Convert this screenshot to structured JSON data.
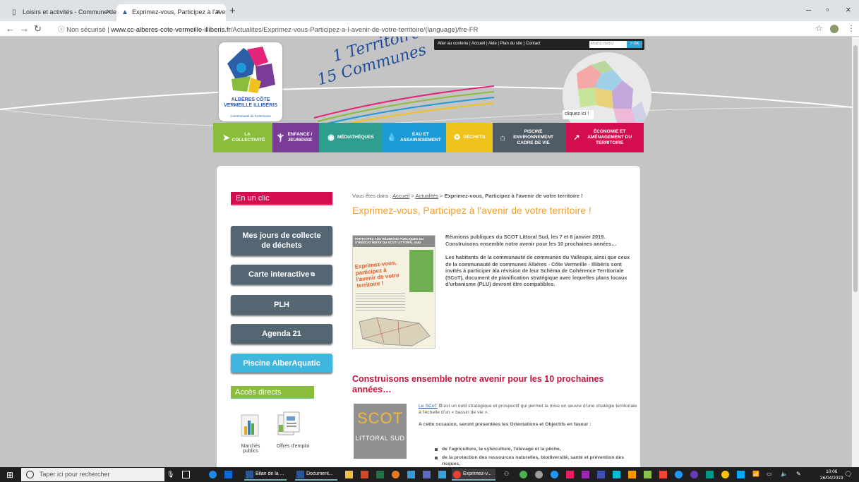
{
  "browser": {
    "tabs": [
      {
        "label": "Loisirs et activités - Commune de"
      },
      {
        "label": "Exprimez-vous, Participez à l'aven"
      }
    ],
    "security_label": "Non sécurisé",
    "url_host": "www.cc-alberes-cote-vermeille-illiberis.fr",
    "url_path": "/Actualites/Exprimez-vous-Participez-a-l-avenir-de-votre-territoire/(language)/fre-FR"
  },
  "header": {
    "logo_name": "ALBÈRES CÔTE VERMEILLE ILLIBÉRIS",
    "logo_sub": "Communauté de Communes",
    "slogan_line1": "1 Territoire",
    "slogan_line2": "15 Communes",
    "top_links": [
      "Aller au contenu",
      "Accueil",
      "Aide",
      "Plan du site",
      "Contact"
    ],
    "search_placeholder": "Mot(s) clef(s)",
    "search_button": "> OK",
    "map_label": "cliquez ici !"
  },
  "menu": [
    {
      "label": "LA COLLECTIVITÉ",
      "color": "#8bbd3c"
    },
    {
      "label": "ENFANCE / JEUNESSE",
      "color": "#7a3d97"
    },
    {
      "label": "MÉDIATHÈQUES",
      "color": "#2f9e8f"
    },
    {
      "label": "EAU ET ASSAINISSEMENT",
      "color": "#1d9bd7"
    },
    {
      "label": "DÉCHETS",
      "color": "#f0c31c"
    },
    {
      "label": "PISCINE ENVIRONNEMENT CADRE DE VIE",
      "color": "#4f5b66"
    },
    {
      "label": "ÉCONOMIE ET AMÉNAGEMENT DU TERRITOIRE",
      "color": "#d40d4f"
    }
  ],
  "sidebar": {
    "heading": "En un clic",
    "buttons": [
      {
        "label": "Mes jours de collecte de déchets"
      },
      {
        "label": "Carte interactive"
      },
      {
        "label": "PLH"
      },
      {
        "label": "Agenda 21"
      },
      {
        "label": "Piscine AlberAquatic"
      }
    ],
    "acces_heading": "Accès directs",
    "direct_links": [
      {
        "label": "Marchés publics"
      },
      {
        "label": "Offres d'emploi"
      }
    ]
  },
  "article": {
    "breadcrumb_prefix": "Vous êtes dans :",
    "breadcrumb_home": "Accueil",
    "breadcrumb_news": "Actualités",
    "breadcrumb_current": "Exprimez-vous, Participez à l'avenir de votre territoire !",
    "title": "Exprimez-vous, Participez à l'avenir de votre territoire !",
    "poster_banner": "PARTICIPEZ AUX RÉUNIONS PUBLIQUES DU SYNDICAT MIXTE DU SCOT LITTORAL SUD",
    "poster_title": "Exprimez-vous, participez à l'avenir de votre territoire !",
    "intro_p1": "Réunions publiques du SCOT Littoral Sud, les 7 et 8 janvier 2019. Construisons ensemble notre avenir pour les 10 prochaines années…",
    "intro_p2": "Les habitants de la communauté de communes du Vallespir, ainsi que ceux de la communauté de communes Albères - Côte Vermeille - Illibéris sont invités à participer àla révision de leur Schéma de Cohérence Territoriale (SCoT), document de planification stratégique avec lequelles plans locaux d'urbanisme (PLU) devront être compatibles.",
    "h2": "Construisons ensemble notre avenir pour les 10 prochaines années…",
    "scot_logo_top": "SCOT",
    "scot_logo_bottom": "LITTORAL SUD",
    "scot_link": "Le SCoT",
    "p3_rest": "est un outil stratégique et prospectif qui permet la mise en œuvre d'une stratégie territoriale à l'échelle d'un « bassin de vie ».",
    "p4": "A cette occasion, seront présentées les Orientations et Objectifs en faveur :",
    "bullets": [
      "de l'agriculture, la sylviculture, l'élevage et la pêche,",
      "de la protection des ressources naturelles, biodiversité, santé et prévention des risques,"
    ]
  },
  "taskbar": {
    "search_placeholder": "Taper ici pour rechercher",
    "apps": [
      {
        "label": "Bilan de la ..."
      },
      {
        "label": "Document..."
      },
      {
        "label": "Exprimez-v..."
      }
    ],
    "time": "10:06",
    "date": "26/04/2019"
  }
}
